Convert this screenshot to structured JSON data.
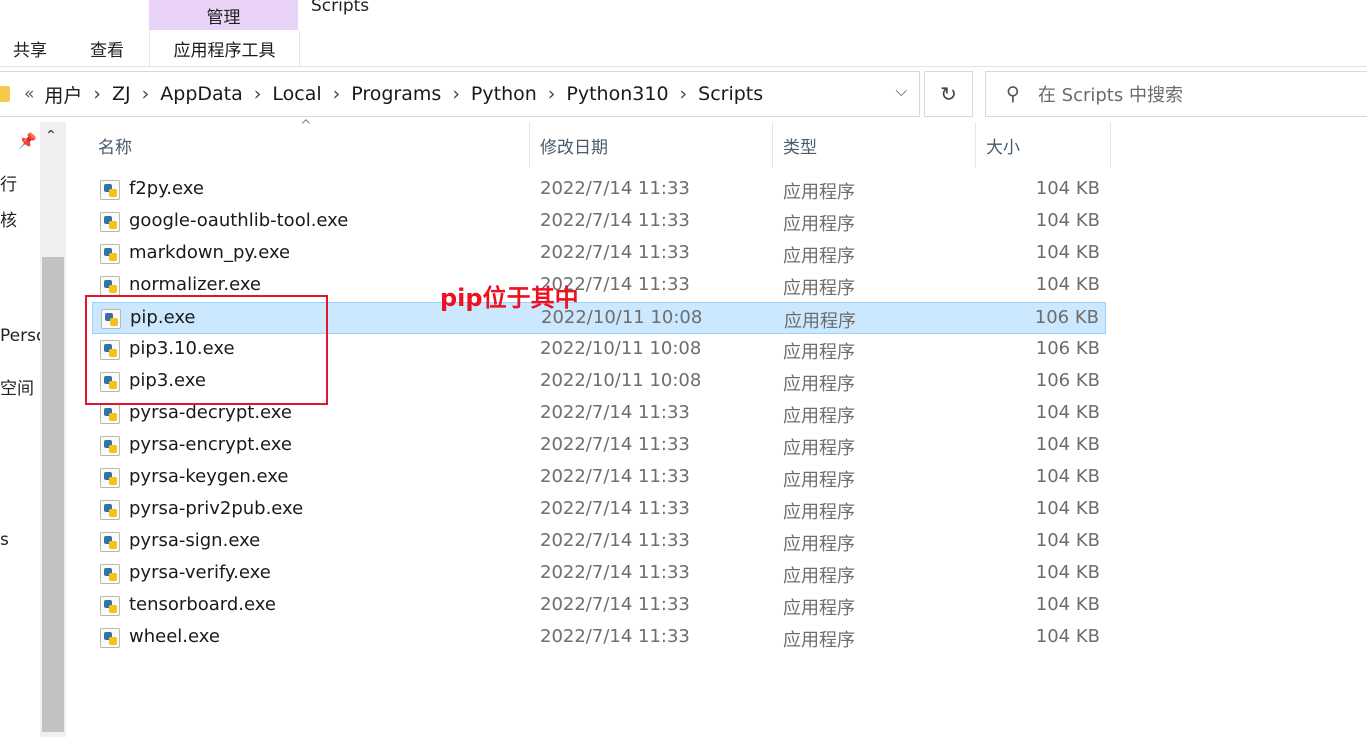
{
  "ribbon": {
    "context_tab": "管理",
    "window_title": "Scripts",
    "tabs": [
      "共享",
      "查看"
    ],
    "context_subtab": "应用程序工具"
  },
  "address": {
    "overflow": "«",
    "crumbs": [
      "用户",
      "ZJ",
      "AppData",
      "Local",
      "Programs",
      "Python",
      "Python310",
      "Scripts"
    ]
  },
  "search": {
    "placeholder": "在 Scripts 中搜索"
  },
  "nav": {
    "items": [
      "行",
      "核",
      "Persc",
      "空间",
      "s"
    ]
  },
  "columns": {
    "name": "名称",
    "date": "修改日期",
    "type": "类型",
    "size": "大小"
  },
  "files": [
    {
      "name": "f2py.exe",
      "date": "2022/7/14 11:33",
      "type": "应用程序",
      "size": "104 KB"
    },
    {
      "name": "google-oauthlib-tool.exe",
      "date": "2022/7/14 11:33",
      "type": "应用程序",
      "size": "104 KB"
    },
    {
      "name": "markdown_py.exe",
      "date": "2022/7/14 11:33",
      "type": "应用程序",
      "size": "104 KB"
    },
    {
      "name": "normalizer.exe",
      "date": "2022/7/14 11:33",
      "type": "应用程序",
      "size": "104 KB"
    },
    {
      "name": "pip.exe",
      "date": "2022/10/11 10:08",
      "type": "应用程序",
      "size": "106 KB"
    },
    {
      "name": "pip3.10.exe",
      "date": "2022/10/11 10:08",
      "type": "应用程序",
      "size": "106 KB"
    },
    {
      "name": "pip3.exe",
      "date": "2022/10/11 10:08",
      "type": "应用程序",
      "size": "106 KB"
    },
    {
      "name": "pyrsa-decrypt.exe",
      "date": "2022/7/14 11:33",
      "type": "应用程序",
      "size": "104 KB"
    },
    {
      "name": "pyrsa-encrypt.exe",
      "date": "2022/7/14 11:33",
      "type": "应用程序",
      "size": "104 KB"
    },
    {
      "name": "pyrsa-keygen.exe",
      "date": "2022/7/14 11:33",
      "type": "应用程序",
      "size": "104 KB"
    },
    {
      "name": "pyrsa-priv2pub.exe",
      "date": "2022/7/14 11:33",
      "type": "应用程序",
      "size": "104 KB"
    },
    {
      "name": "pyrsa-sign.exe",
      "date": "2022/7/14 11:33",
      "type": "应用程序",
      "size": "104 KB"
    },
    {
      "name": "pyrsa-verify.exe",
      "date": "2022/7/14 11:33",
      "type": "应用程序",
      "size": "104 KB"
    },
    {
      "name": "tensorboard.exe",
      "date": "2022/7/14 11:33",
      "type": "应用程序",
      "size": "104 KB"
    },
    {
      "name": "wheel.exe",
      "date": "2022/7/14 11:33",
      "type": "应用程序",
      "size": "104 KB"
    }
  ],
  "selected_file": "pip.exe",
  "annotation": {
    "text": "pip位于其中",
    "color": "#e0182d"
  },
  "colors": {
    "selection": "#cce8ff",
    "context_tab": "#e9d3f7",
    "accent_red": "#e0182d"
  }
}
